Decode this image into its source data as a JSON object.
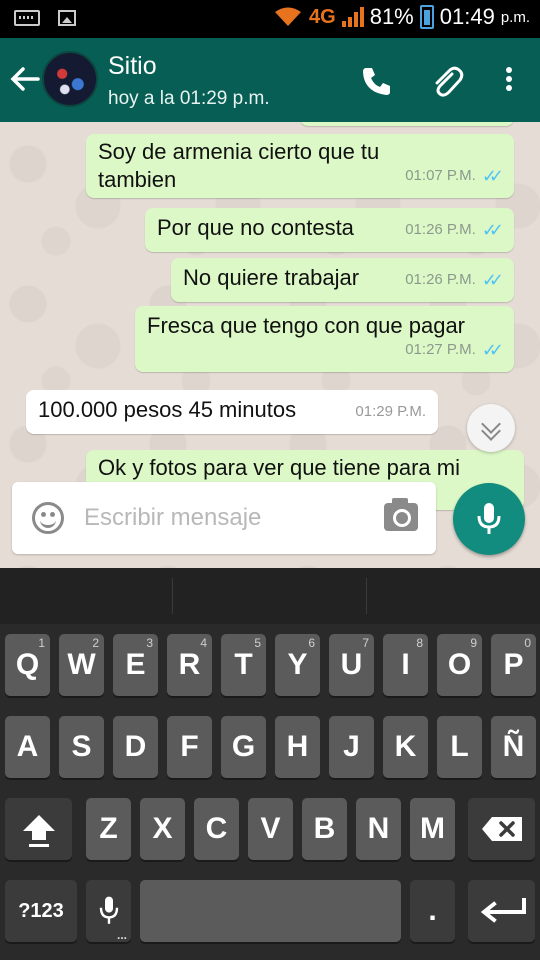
{
  "status_bar": {
    "network": "4G",
    "battery": "81%",
    "time": "01:49",
    "ampm": "p.m."
  },
  "header": {
    "contact_name": "Sitio",
    "last_seen": "hoy a la 01:29 p.m."
  },
  "messages": [
    {
      "direction": "out",
      "text_line1": "Soy de armenia cierto que tu",
      "text_line2": "tambien",
      "time": "01:07 P.M.",
      "ticks": "✓✓"
    },
    {
      "direction": "out",
      "text_line1": "Por que no contesta",
      "time": "01:26 P.M.",
      "ticks": "✓✓"
    },
    {
      "direction": "out",
      "text_line1": "No quiere trabajar",
      "time": "01:26 P.M.",
      "ticks": "✓✓"
    },
    {
      "direction": "out",
      "text_line1": "Fresca que tengo con que pagar",
      "time": "01:27 P.M.",
      "ticks": "✓✓"
    },
    {
      "direction": "in",
      "text_line1": "100.000 pesos 45 minutos",
      "time": "01:29 P.M."
    },
    {
      "direction": "out",
      "text_line1": "Ok y fotos para ver que tiene para mi"
    }
  ],
  "composer": {
    "placeholder": "Escribir mensaje"
  },
  "keyboard": {
    "row1": [
      {
        "label": "Q",
        "hint": "1"
      },
      {
        "label": "W",
        "hint": "2"
      },
      {
        "label": "E",
        "hint": "3"
      },
      {
        "label": "R",
        "hint": "4"
      },
      {
        "label": "T",
        "hint": "5"
      },
      {
        "label": "Y",
        "hint": "6"
      },
      {
        "label": "U",
        "hint": "7"
      },
      {
        "label": "I",
        "hint": "8"
      },
      {
        "label": "O",
        "hint": "9"
      },
      {
        "label": "P",
        "hint": "0"
      }
    ],
    "row2": [
      "A",
      "S",
      "D",
      "F",
      "G",
      "H",
      "J",
      "K",
      "L",
      "Ñ"
    ],
    "row3": [
      "Z",
      "X",
      "C",
      "V",
      "B",
      "N",
      "M"
    ],
    "symbols_label": "?123",
    "period_label": "."
  },
  "colors": {
    "header": "#075e54",
    "outgoing_bubble": "#dcf8c6",
    "incoming_bubble": "#ffffff",
    "chat_background": "#e5ddd5",
    "mic_button": "#128c7e",
    "read_ticks": "#4fc3f7",
    "network_indicator": "#e8731f"
  },
  "icons": [
    "keyboard-icon",
    "image-icon",
    "wifi-icon",
    "signal-icon",
    "battery-icon",
    "back-arrow-icon",
    "phone-icon",
    "paperclip-icon",
    "more-icon",
    "emoji-icon",
    "camera-icon",
    "mic-icon",
    "chevron-down-icon",
    "shift-icon",
    "backspace-icon",
    "enter-icon"
  ]
}
